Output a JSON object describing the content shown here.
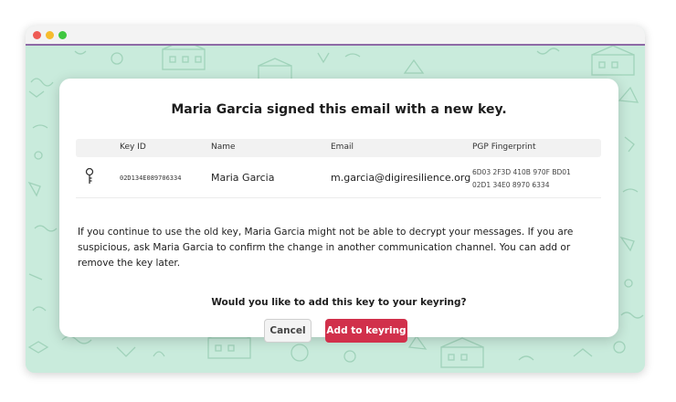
{
  "dialog": {
    "title": "Maria Garcia signed this email with a new key.",
    "table": {
      "headers": {
        "key_id": "Key ID",
        "name": "Name",
        "email": "Email",
        "fingerprint": "PGP Fingerprint"
      },
      "row": {
        "icon": "key-icon",
        "key_id": "02D134E089706334",
        "name": "Maria Garcia",
        "email": "m.garcia@digiresilience.org",
        "fingerprint_line1": "6D03 2F3D 410B 970F BD01",
        "fingerprint_line2": "02D1 34E0 8970 6334"
      }
    },
    "message": "If you continue to use the old key, Maria Garcia might not be able to decrypt your messages. If you are suspicious, ask Maria Garcia to confirm the change in another communication channel. You can add or remove the key later.",
    "question": "Would you like to add this key to your keyring?",
    "buttons": {
      "cancel": "Cancel",
      "add": "Add to keyring"
    }
  },
  "colors": {
    "primary_button": "#d1304b",
    "background_pattern": "#c9ebdc",
    "window_accent": "#8e6aa6"
  }
}
